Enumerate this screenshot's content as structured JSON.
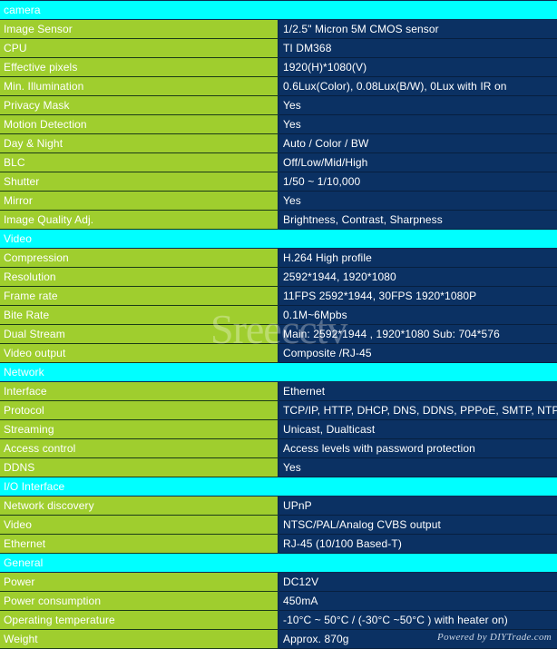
{
  "colors": {
    "section_header_bg": "#00ffff",
    "section_header_text": "#ffffff",
    "label_bg": "#9fce2e",
    "label_text": "#ffffff",
    "value_bg": "#0b3163",
    "value_text": "#ffffff"
  },
  "watermark": "Sreecctv",
  "powered_by": "Powered by DIYTrade.com",
  "rows": [
    {
      "type": "section",
      "label": "camera"
    },
    {
      "type": "spec",
      "label": "Image Sensor",
      "value": "1/2.5\" Micron 5M CMOS sensor"
    },
    {
      "type": "spec",
      "label": "CPU",
      "value": "TI DM368"
    },
    {
      "type": "spec",
      "label": "Effective pixels",
      "value": "1920(H)*1080(V)"
    },
    {
      "type": "spec",
      "label": "Min. Illumination",
      "value": "0.6Lux(Color), 0.08Lux(B/W), 0Lux with IR on"
    },
    {
      "type": "spec",
      "label": "Privacy Mask",
      "value": "Yes"
    },
    {
      "type": "spec",
      "label": "Motion Detection",
      "value": "Yes"
    },
    {
      "type": "spec",
      "label": "Day & Night",
      "value": "Auto / Color / BW"
    },
    {
      "type": "spec",
      "label": "BLC",
      "value": "Off/Low/Mid/High"
    },
    {
      "type": "spec",
      "label": "Shutter",
      "value": "1/50 ~ 1/10,000"
    },
    {
      "type": "spec",
      "label": "Mirror",
      "value": "Yes"
    },
    {
      "type": "spec",
      "label": "Image Quality Adj.",
      "value": "Brightness, Contrast, Sharpness"
    },
    {
      "type": "section",
      "label": "Video"
    },
    {
      "type": "spec",
      "label": "Compression",
      "value": "H.264 High profile"
    },
    {
      "type": "spec",
      "label": "Resolution",
      "value": "2592*1944, 1920*1080"
    },
    {
      "type": "spec",
      "label": "Frame rate",
      "value": "11FPS 2592*1944, 30FPS 1920*1080P"
    },
    {
      "type": "spec",
      "label": "Bite Rate",
      "value": "0.1M~6Mpbs"
    },
    {
      "type": "spec",
      "label": "Dual Stream",
      "value": "Main: 2592*1944 , 1920*1080 Sub: 704*576"
    },
    {
      "type": "spec",
      "label": "Video output",
      "value": "Composite /RJ-45"
    },
    {
      "type": "section",
      "label": "Network"
    },
    {
      "type": "spec",
      "label": "Interface",
      "value": "Ethernet"
    },
    {
      "type": "spec",
      "label": "Protocol",
      "value": "TCP/IP, HTTP, DHCP, DNS, DDNS, PPPoE, SMTP, NTP etc…"
    },
    {
      "type": "spec",
      "label": "Streaming",
      "value": "Unicast, Dualticast"
    },
    {
      "type": "spec",
      "label": "Access control",
      "value": "Access levels with password protection"
    },
    {
      "type": "spec",
      "label": "DDNS",
      "value": "Yes"
    },
    {
      "type": "section",
      "label": "I/O Interface"
    },
    {
      "type": "spec",
      "label": "Network discovery",
      "value": "UPnP"
    },
    {
      "type": "spec",
      "label": "Video",
      "value": "NTSC/PAL/Analog CVBS output"
    },
    {
      "type": "spec",
      "label": "Ethernet",
      "value": "RJ-45 (10/100 Based-T)"
    },
    {
      "type": "section",
      "label": "General"
    },
    {
      "type": "spec",
      "label": "Power",
      "value": "DC12V"
    },
    {
      "type": "spec",
      "label": "Power consumption",
      "value": "450mA"
    },
    {
      "type": "spec",
      "label": "Operating temperature",
      "value": "-10°C ~ 50°C / (-30°C ~50°C ) with heater on)"
    },
    {
      "type": "spec",
      "label": "Weight",
      "value": "Approx. 870g"
    }
  ]
}
